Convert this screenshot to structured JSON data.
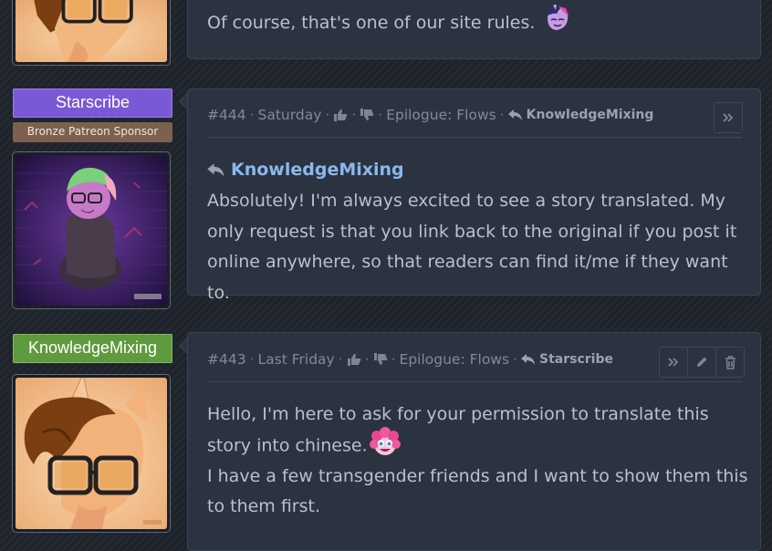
{
  "top_comment": {
    "text": "Of course, that's one of our site rules.",
    "emote_icon": "twilight-sparkle-emote-icon"
  },
  "comment_444": {
    "author": {
      "name": "Starscribe",
      "badge": "Bronze Patreon Sponsor",
      "name_color": "#7a58d6"
    },
    "number": "#444",
    "date": "Saturday",
    "chapter": "Epilogue: Flows",
    "reply_to": "KnowledgeMixing",
    "reply_heading": "KnowledgeMixing",
    "body": "Absolutely! I'm always excited to see a story translated. My only request is that you link back to the original if you post it online anywhere, so that readers can find it/me if they want to.",
    "actions": [
      "expand"
    ]
  },
  "comment_443": {
    "author": {
      "name": "KnowledgeMixing",
      "name_color": "#5f9a3e"
    },
    "number": "#443",
    "date": "Last Friday",
    "chapter": "Epilogue: Flows",
    "reply_to": "Starscribe",
    "body_line1": "Hello, I'm here to ask for your permission to translate this story into chinese.",
    "emote_icon": "pinkie-pie-emote-icon",
    "body_line2": "I have a few transgender friends and I want to show them this to them first.",
    "actions": [
      "expand",
      "edit",
      "delete"
    ]
  },
  "separator": "·"
}
